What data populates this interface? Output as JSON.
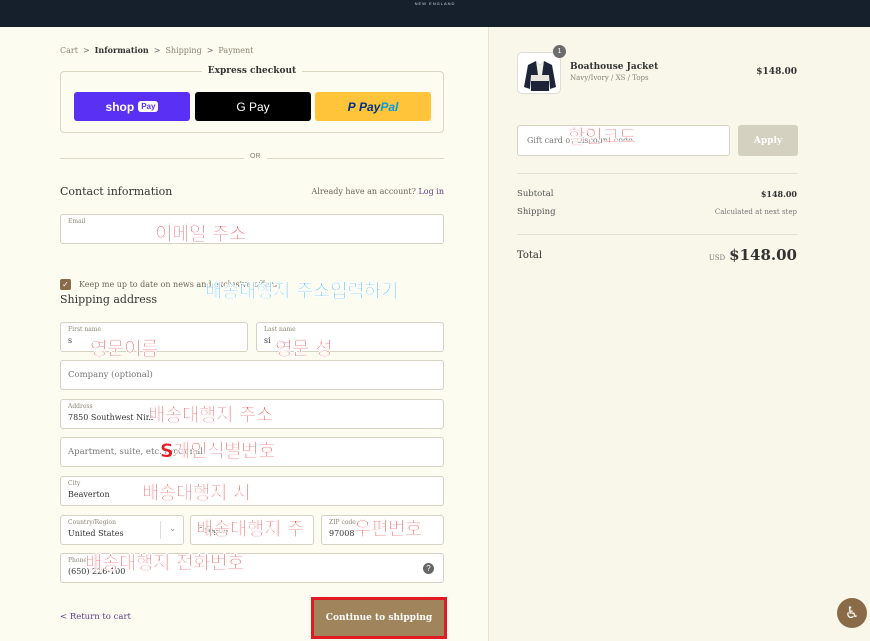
{
  "brand": "NEW ENGLAND",
  "breadcrumb": {
    "cart": "Cart",
    "information": "Information",
    "shipping": "Shipping",
    "payment": "Payment",
    "sep": ">"
  },
  "express": {
    "title": "Express checkout",
    "shop_label": "shop",
    "shop_badge": "Pay",
    "gpay_label": "G Pay",
    "paypal_p": "P",
    "paypal_a": "Pay",
    "paypal_b": "Pal"
  },
  "or_label": "OR",
  "contact": {
    "heading": "Contact information",
    "account_prompt": "Already have an account?",
    "login_link": "Log in",
    "email_label": "Email",
    "email_value": "",
    "newsletter_label": "Keep me up to date on news and exclusive offers"
  },
  "shipping": {
    "heading": "Shipping address",
    "first_name_label": "First name",
    "first_name_value": "s",
    "last_name_label": "Last name",
    "last_name_value": "si",
    "company_placeholder": "Company (optional)",
    "address_label": "Address",
    "address_value": "7850 Southwest Nim",
    "apartment_placeholder": "Apartment, suite, etc. (optional)",
    "city_label": "City",
    "city_value": "Beaverton",
    "country_label": "Country/Region",
    "country_value": "United States",
    "state_value": "Oregon",
    "zip_label": "ZIP code",
    "zip_value": "97008",
    "phone_label": "Phone",
    "phone_value": "(650) 226-100"
  },
  "annotations": {
    "email": "이메일 주소",
    "shipping_heading": "배송대행지 주소입력하기",
    "first_name": "영문이름",
    "last_name": "영문 성",
    "address": "배송대행지 주소",
    "apartment": "S개인식별번호",
    "city": "배송대행지 시",
    "state": "배송대행지 주",
    "zip": "우편번호",
    "phone": "배송대행지 전화번호",
    "discount": "할인코드"
  },
  "footer": {
    "return_link": "< Return to cart",
    "continue_button": "Continue to shipping"
  },
  "summary": {
    "qty": "1",
    "product_name": "Boathouse Jacket",
    "product_variant": "Navy/Ivory / XS / Tops",
    "product_price": "$148.00",
    "gift_placeholder": "Gift card or discount code",
    "apply_label": "Apply",
    "subtotal_label": "Subtotal",
    "subtotal_value": "$148.00",
    "shipping_label": "Shipping",
    "shipping_value": "Calculated at next step",
    "total_label": "Total",
    "total_currency": "USD",
    "total_value": "$148.00"
  },
  "colors": {
    "primary": "#a0855c",
    "annotation_red": "#e01b24",
    "annotation_blue": "#23a9e6",
    "topbar": "#16202c"
  },
  "icons": {
    "help": "question-circle-icon",
    "accessibility": "accessibility-icon",
    "select": "chevron-down-icon"
  }
}
